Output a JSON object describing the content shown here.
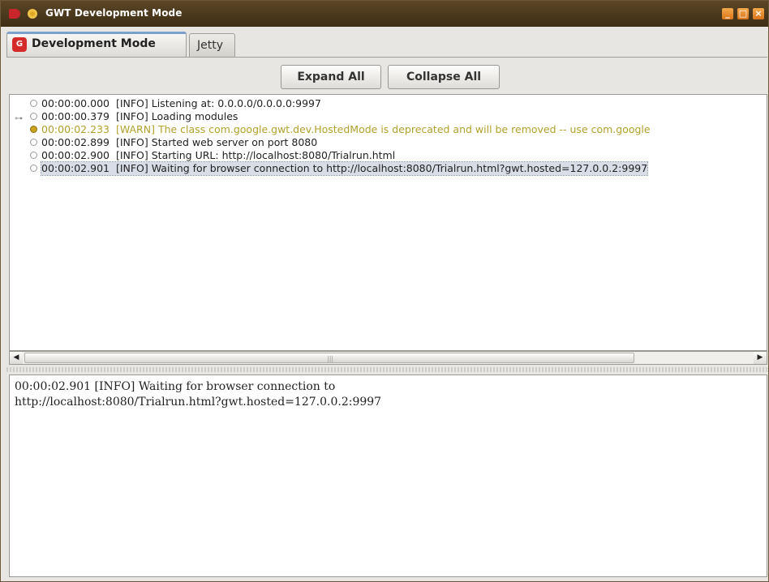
{
  "window": {
    "title": "GWT Development Mode",
    "minimize_glyph": "_",
    "maximize_glyph": "□",
    "close_glyph": "×"
  },
  "tabs": [
    {
      "label": "Development Mode",
      "icon": "gwt-icon",
      "icon_glyph": "G",
      "selected": true
    },
    {
      "label": "Jetty",
      "selected": false
    }
  ],
  "toolbar": {
    "expand_label": "Expand All",
    "collapse_label": "Collapse All"
  },
  "log": {
    "tree_connector": "⊶",
    "entries": [
      {
        "time": "00:00:00.000",
        "level": "[INFO]",
        "message": "Listening at: 0.0.0.0/0.0.0.0:9997"
      },
      {
        "time": "00:00:00.379",
        "level": "[INFO]",
        "message": "Loading modules"
      },
      {
        "time": "00:00:02.233",
        "level": "[WARN]",
        "message": "The class com.google.gwt.dev.HostedMode is deprecated and will be removed -- use com.google"
      },
      {
        "time": "00:00:02.899",
        "level": "[INFO]",
        "message": "Started web server on port 8080"
      },
      {
        "time": "00:00:02.900",
        "level": "[INFO]",
        "message": "Starting URL: http://localhost:8080/Trialrun.html"
      },
      {
        "time": "00:00:02.901",
        "level": "[INFO]",
        "message": "Waiting for browser connection to http://localhost:8080/Trialrun.html?gwt.hosted=127.0.0.2:9997"
      }
    ]
  },
  "scrollbar": {
    "left_arrow": "◀",
    "right_arrow": "▶",
    "grip": "|||"
  },
  "details": {
    "line1": "00:00:02.901 [INFO] Waiting for browser connection to",
    "line2": "http://localhost:8080/Trialrun.html?gwt.hosted=127.0.0.2:9997"
  },
  "colors": {
    "titlebar": "#4a381c",
    "accent_tab": "#7ca0cc",
    "warn_text": "#b0a12c",
    "selection": "#d8dde8"
  }
}
